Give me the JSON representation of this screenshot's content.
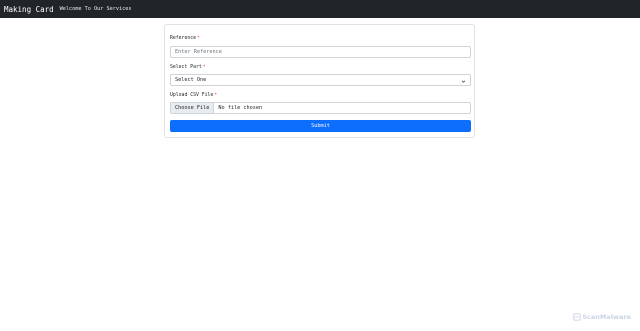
{
  "navbar": {
    "brand": "Making Card",
    "tagline": "Welcome To Our Services"
  },
  "form": {
    "reference": {
      "label": "Reference",
      "required_mark": "*",
      "placeholder": "Enter Reference"
    },
    "part": {
      "label": "Select Part",
      "required_mark": "*",
      "selected": "Select One"
    },
    "upload": {
      "label": "Upload CSV File",
      "required_mark": "*",
      "button": "Choose File",
      "status": "No file chosen"
    },
    "submit": "Submit"
  },
  "watermark": "ScanMalware",
  "colors": {
    "navbar_bg": "#212529",
    "primary": "#0d6efd",
    "required": "#dc3545"
  }
}
